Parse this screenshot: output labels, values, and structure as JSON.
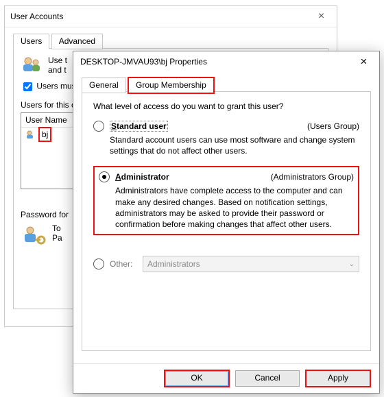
{
  "win1": {
    "title": "User Accounts",
    "tabs": [
      "Users",
      "Advanced"
    ],
    "use_line1": "Use t",
    "use_line2": "and t",
    "checkbox_label": "Users must",
    "users_for_label": "Users for this c",
    "column_header": "User Name",
    "row0_user": "bj",
    "pwd_label": "Password for",
    "pwd_line1": "To",
    "pwd_line2": "Pa"
  },
  "win2": {
    "title": "DESKTOP-JMVAU93\\bj Properties",
    "tabs": [
      "General",
      "Group Membership"
    ],
    "question": "What level of access do you want to grant this user?",
    "standard": {
      "label_pre": "S",
      "label_rest": "tandard user",
      "group": "(Users Group)",
      "desc": "Standard account users can use most software and change system settings that do not affect other users."
    },
    "admin": {
      "label_pre": "A",
      "label_rest": "dministrator",
      "group": "(Administrators Group)",
      "desc": "Administrators have complete access to the computer and can make any desired changes. Based on notification settings, administrators may be asked to provide their password or confirmation before making changes that affect other users."
    },
    "other": {
      "label_pre": "O",
      "label_rest": "ther:",
      "combo_value": "Administrators"
    },
    "buttons": {
      "ok": "OK",
      "cancel": "Cancel",
      "apply": "Apply"
    }
  }
}
